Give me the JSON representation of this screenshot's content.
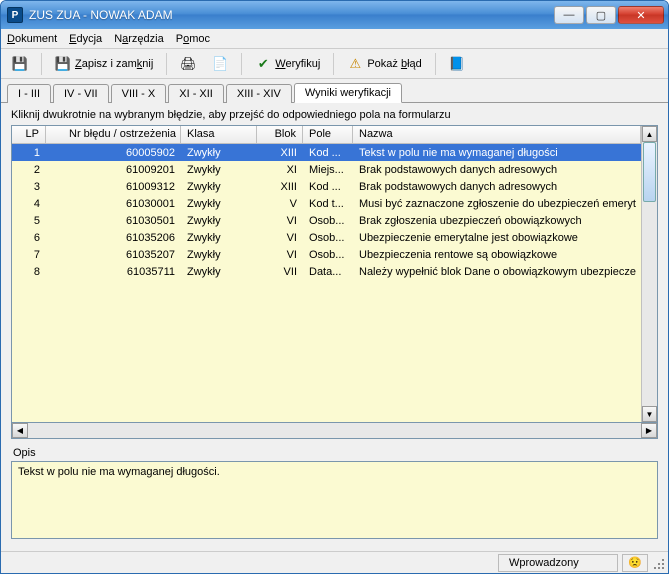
{
  "window": {
    "title": "ZUS ZUA - NOWAK ADAM"
  },
  "menu": {
    "dokument": "Dokument",
    "edycja": "Edycja",
    "narzedzia": "Narzędzia",
    "pomoc": "Pomoc"
  },
  "toolbar": {
    "save_close": "Zapisz i zamknij",
    "verify": "Weryfikuj",
    "show_error": "Pokaż błąd"
  },
  "tabs": {
    "t1": "I - III",
    "t2": "IV - VII",
    "t3": "VIII - X",
    "t4": "XI - XII",
    "t5": "XIII - XIV",
    "t6": "Wyniki weryfikacji"
  },
  "hint": "Kliknij dwukrotnie na wybranym błędzie, aby przejść do odpowiedniego pola na formularzu",
  "columns": {
    "lp": "LP",
    "err": "Nr błędu / ostrzeżenia",
    "klasa": "Klasa",
    "blok": "Blok",
    "pole": "Pole",
    "nazwa": "Nazwa"
  },
  "rows": [
    {
      "lp": "1",
      "err": "60005902",
      "klasa": "Zwykły",
      "blok": "XIII",
      "pole": "Kod ...",
      "nazwa": "Tekst w polu nie ma wymaganej długości"
    },
    {
      "lp": "2",
      "err": "61009201",
      "klasa": "Zwykły",
      "blok": "XI",
      "pole": "Miejs...",
      "nazwa": "Brak podstawowych danych adresowych"
    },
    {
      "lp": "3",
      "err": "61009312",
      "klasa": "Zwykły",
      "blok": "XIII",
      "pole": "Kod ...",
      "nazwa": "Brak podstawowych danych adresowych"
    },
    {
      "lp": "4",
      "err": "61030001",
      "klasa": "Zwykły",
      "blok": "V",
      "pole": "Kod t...",
      "nazwa": "Musi być zaznaczone zgłoszenie do ubezpieczeń emeryt"
    },
    {
      "lp": "5",
      "err": "61030501",
      "klasa": "Zwykły",
      "blok": "VI",
      "pole": "Osob...",
      "nazwa": "Brak zgłoszenia ubezpieczeń obowiązkowych"
    },
    {
      "lp": "6",
      "err": "61035206",
      "klasa": "Zwykły",
      "blok": "VI",
      "pole": "Osob...",
      "nazwa": "Ubezpieczenie emerytalne jest obowiązkowe"
    },
    {
      "lp": "7",
      "err": "61035207",
      "klasa": "Zwykły",
      "blok": "VI",
      "pole": "Osob...",
      "nazwa": "Ubezpieczenia rentowe są obowiązkowe"
    },
    {
      "lp": "8",
      "err": "61035711",
      "klasa": "Zwykły",
      "blok": "VII",
      "pole": "Data...",
      "nazwa": "Należy wypełnić blok Dane o obowiązkowym ubezpiecze"
    }
  ],
  "selected_index": 0,
  "description_label": "Opis",
  "description_text": "Tekst w polu nie ma wymaganej długości.",
  "status": {
    "state": "Wprowadzony"
  },
  "icons": {
    "save": "💾",
    "save_close": "💾",
    "print": "🖨",
    "preview": "📄",
    "check": "✔",
    "warn": "⚠",
    "help": "📘",
    "sad": "😟"
  }
}
